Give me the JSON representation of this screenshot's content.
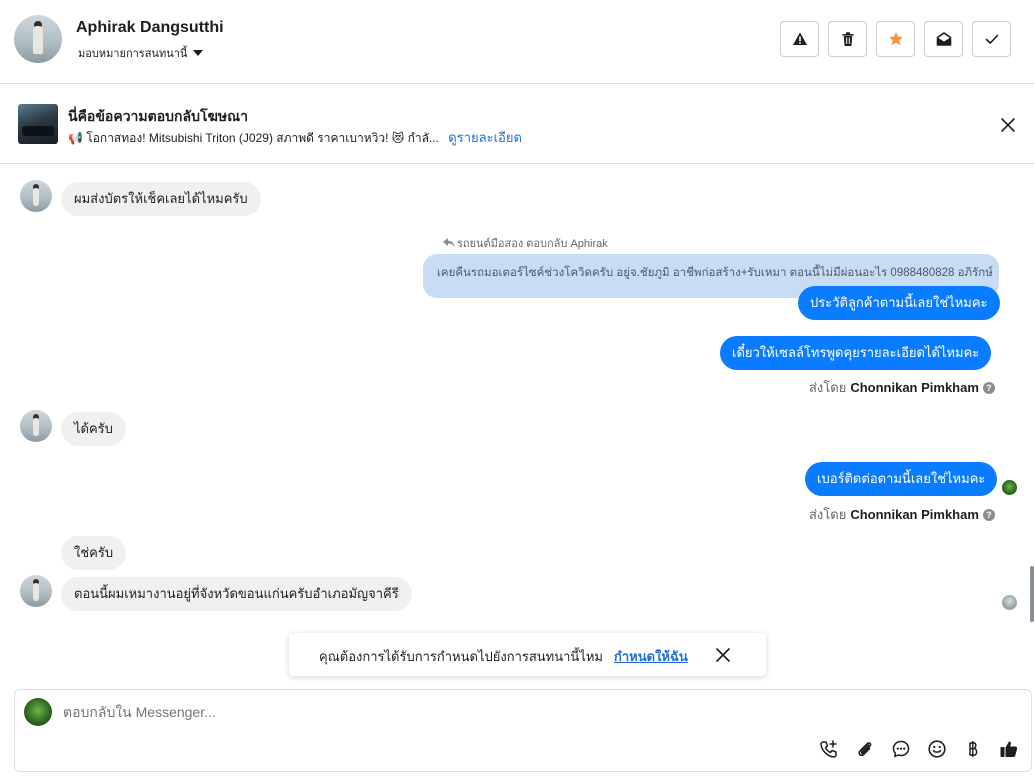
{
  "header": {
    "name": "Aphirak Dangsutthi",
    "assign_label": "มอบหมายการสนทนานี้",
    "actions": [
      {
        "name": "report-button",
        "icon": "warning-icon"
      },
      {
        "name": "delete-button",
        "icon": "trash-icon"
      },
      {
        "name": "star-button",
        "icon": "star-icon"
      },
      {
        "name": "mark-unread-button",
        "icon": "envelope-open-icon"
      },
      {
        "name": "mark-done-button",
        "icon": "check-icon"
      }
    ],
    "star_color": "#f7923b"
  },
  "ad_banner": {
    "title": "นี่คือข้อความตอบกลับโฆษณา",
    "text": "📢 โอกาสทอง! Mitsubishi Triton (J029) สภาพดี ราคาเบาหวิว! 😻 กำลั...",
    "link": "ดูรายละเอียด"
  },
  "messages": {
    "m1": "ผมส่งบัตรให้เช็คเลยได้ไหมครับ",
    "quote_meta": "รถยนต์มือสอง ตอบกลับ Aphirak",
    "quote_text": "เคยคืนรถมอเตอร์ไซค์ช่วงโควิดครับ อยู่จ.ชัยภูมิ อาชีพก่อสร้าง+รับเหมา ตอนนี้ไม่มีผ่อนอะไร 0988480828 อภิรักษ์",
    "m2": "ประวัติลูกค้าตามนี้เลยใช่ไหมคะ",
    "m3": "เดี๋ยวให้เซลล์โทรพูดคุยรายละเอียดได้ไหมคะ",
    "sent_by_prefix": "ส่งโดย",
    "sent_by_name": "Chonnikan Pimkham",
    "m4": "ได้ครับ",
    "m5": "เบอร์ติดต่อตามนี้เลยใช่ไหมคะ",
    "m6": "ใช่ครับ",
    "m7": "ตอนนี้ผมเหมางานอยู่ที่จังหวัดขอนแก่นครับอำเภอมัญจาคีรี"
  },
  "toast": {
    "text": "คุณต้องการได้รับการกำหนดไปยังการสนทนานี้ไหม",
    "link": "กำหนดให้ฉัน"
  },
  "composer": {
    "placeholder": "ตอบกลับใน Messenger...",
    "tools": [
      "call-add-icon",
      "attachment-icon",
      "saved-reply-icon",
      "emoji-icon",
      "baht-icon",
      "like-icon"
    ]
  },
  "colors": {
    "accent_blue": "#0a7cff",
    "link_blue": "#216fdb",
    "incoming_bg": "#f0f0f0",
    "quote_bg": "#c9dcf5"
  }
}
